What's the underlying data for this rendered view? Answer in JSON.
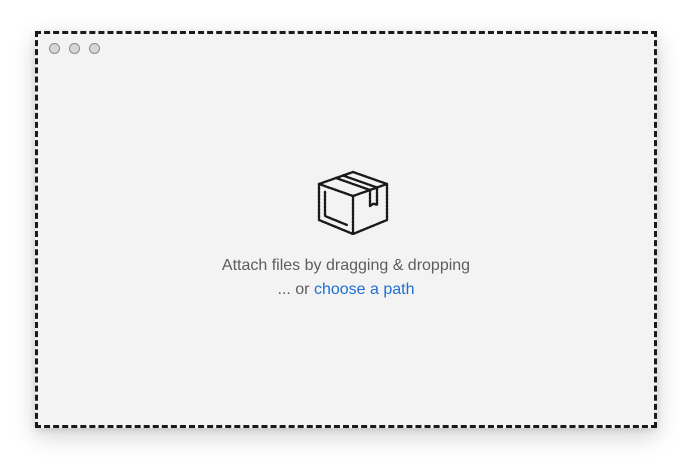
{
  "window": {
    "controls": [
      "close",
      "minimize",
      "zoom"
    ]
  },
  "dropzone": {
    "icon": "package-box-icon",
    "message": "Attach files by dragging & dropping",
    "alt_prefix": "... or ",
    "alt_link": "choose a path"
  },
  "colors": {
    "background": "#f3f3f3",
    "text": "#5d5d5d",
    "link": "#1f6fd1"
  }
}
